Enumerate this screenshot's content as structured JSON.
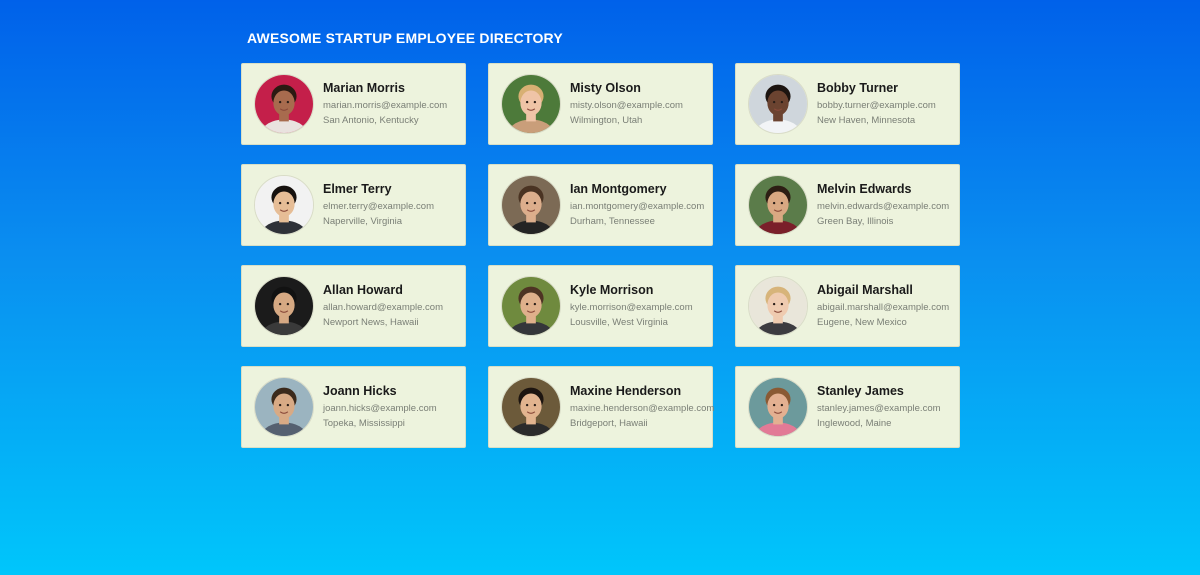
{
  "page": {
    "title": "AWESOME STARTUP EMPLOYEE DIRECTORY"
  },
  "employees": [
    {
      "name": "Marian Morris",
      "email": "marian.morris@example.com",
      "location": "San Antonio, Kentucky",
      "avatar": {
        "bg": "#c41f4a",
        "skin": "#a86b4e",
        "hair": "#2b1a12",
        "shirt": "#e9e2df"
      }
    },
    {
      "name": "Misty Olson",
      "email": "misty.olson@example.com",
      "location": "Wilmington, Utah",
      "avatar": {
        "bg": "#4d7a3a",
        "skin": "#efc4a6",
        "hair": "#d8b073",
        "shirt": "#c99e7a"
      }
    },
    {
      "name": "Bobby Turner",
      "email": "bobby.turner@example.com",
      "location": "New Haven, Minnesota",
      "avatar": {
        "bg": "#cfd6dc",
        "skin": "#6b4330",
        "hair": "#1c1410",
        "shirt": "#f2f4f6"
      }
    },
    {
      "name": "Elmer Terry",
      "email": "elmer.terry@example.com",
      "location": "Naperville, Virginia",
      "avatar": {
        "bg": "#f2f2f2",
        "skin": "#e6bd96",
        "hair": "#16110e",
        "shirt": "#2e3138"
      }
    },
    {
      "name": "Ian Montgomery",
      "email": "ian.montgomery@example.com",
      "location": "Durham, Tennessee",
      "avatar": {
        "bg": "#7c6a55",
        "skin": "#dcae8c",
        "hair": "#4a3322",
        "shirt": "#242424"
      }
    },
    {
      "name": "Melvin Edwards",
      "email": "melvin.edwards@example.com",
      "location": "Green Bay, Illinois",
      "avatar": {
        "bg": "#5b7c4a",
        "skin": "#d9a882",
        "hair": "#2d1e14",
        "shirt": "#7a1f2a"
      }
    },
    {
      "name": "Allan Howard",
      "email": "allan.howard@example.com",
      "location": "Newport News, Hawaii",
      "avatar": {
        "bg": "#1b1b1b",
        "skin": "#d6a983",
        "hair": "#121212",
        "shirt": "#3a3a3a"
      }
    },
    {
      "name": "Kyle Morrison",
      "email": "kyle.morrison@example.com",
      "location": "Lousville, West Virginia",
      "avatar": {
        "bg": "#6f8a3e",
        "skin": "#dfb08b",
        "hair": "#4e3423",
        "shirt": "#34363a"
      }
    },
    {
      "name": "Abigail Marshall",
      "email": "abigail.marshall@example.com",
      "location": "Eugene, New Mexico",
      "avatar": {
        "bg": "#e9e6da",
        "skin": "#efcbb0",
        "hair": "#d7b47a",
        "shirt": "#3c3b40"
      }
    },
    {
      "name": "Joann Hicks",
      "email": "joann.hicks@example.com",
      "location": "Topeka, Mississippi",
      "avatar": {
        "bg": "#9bb4c0",
        "skin": "#d8aa85",
        "hair": "#3b2a1c",
        "shirt": "#556070"
      }
    },
    {
      "name": "Maxine Henderson",
      "email": "maxine.henderson@example.com",
      "location": "Bridgeport, Hawaii",
      "avatar": {
        "bg": "#6c5a3a",
        "skin": "#e2b48f",
        "hair": "#1d1510",
        "shirt": "#2b2b2b"
      }
    },
    {
      "name": "Stanley James",
      "email": "stanley.james@example.com",
      "location": "Inglewood, Maine",
      "avatar": {
        "bg": "#6c9a9c",
        "skin": "#e3b091",
        "hair": "#8a5a34",
        "shirt": "#e27a96"
      }
    }
  ]
}
